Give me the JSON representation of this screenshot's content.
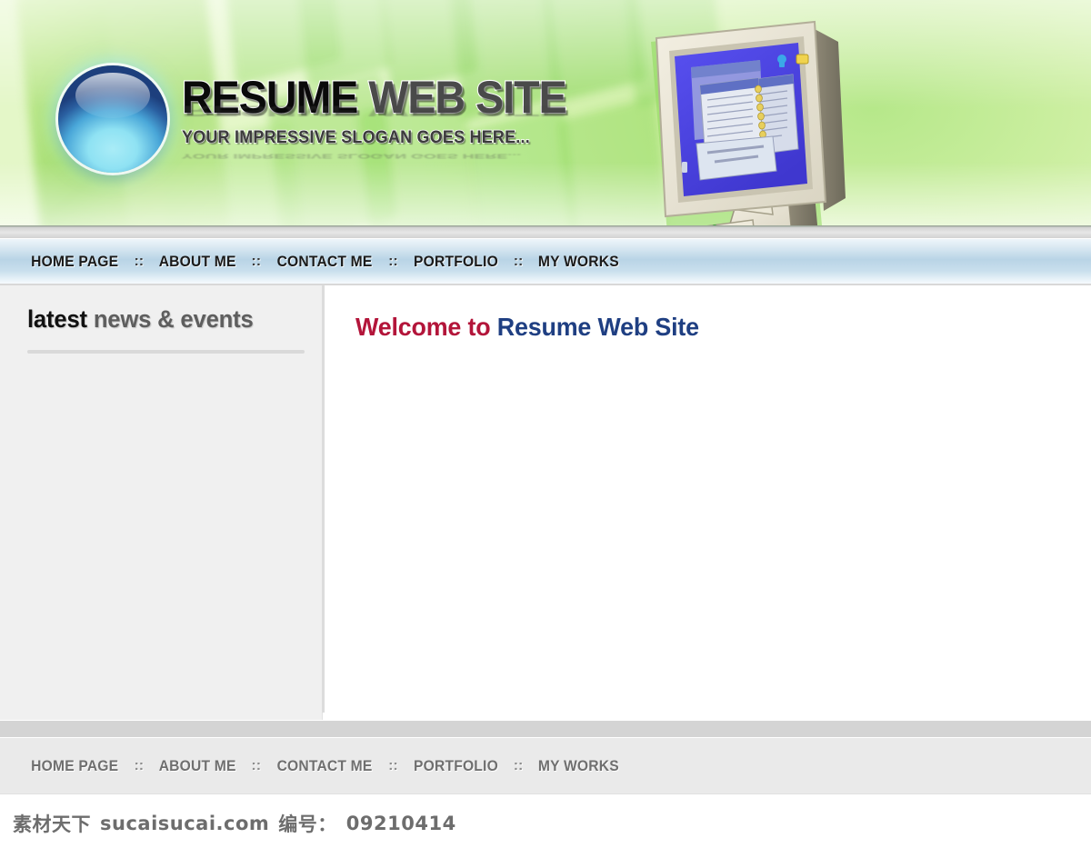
{
  "site": {
    "brand_word1": "RESUME",
    "brand_word2": "WEB SITE",
    "slogan": "YOUR IMPRESSIVE SLOGAN GOES HERE...",
    "logo_icon": "blue-glass-orb-logo"
  },
  "nav": {
    "items": [
      {
        "label": "HOME PAGE"
      },
      {
        "label": "ABOUT ME"
      },
      {
        "label": "CONTACT ME"
      },
      {
        "label": "PORTFOLIO"
      },
      {
        "label": "MY WORKS"
      }
    ],
    "separator": "::"
  },
  "sidebar": {
    "heading_strong": "latest",
    "heading_light": "news & events"
  },
  "main": {
    "welcome_prefix": "Welcome to",
    "welcome_brand": "Resume Web Site"
  },
  "footer": {
    "items": [
      {
        "label": "HOME PAGE"
      },
      {
        "label": "ABOUT ME"
      },
      {
        "label": "CONTACT ME"
      },
      {
        "label": "PORTFOLIO"
      },
      {
        "label": "MY WORKS"
      }
    ],
    "separator": "::"
  },
  "watermark": {
    "site_cn": "素材天下",
    "site_url": "sucaisucai.com",
    "id_label": "编号：",
    "id_value": "09210414"
  },
  "colors": {
    "header_green_light": "#e4f7c8",
    "header_green_mid": "#b6e88a",
    "nav_blue": "#b9d4e6",
    "welcome_red": "#b3153a",
    "welcome_blue": "#1f3f82",
    "sidebar_bg": "#f0f0f0",
    "footer_band": "#d4d4d4",
    "footer_nav_bg": "#eaeaea",
    "monitor_case": "#e4e0d2",
    "monitor_screen": "#4b44e0"
  }
}
